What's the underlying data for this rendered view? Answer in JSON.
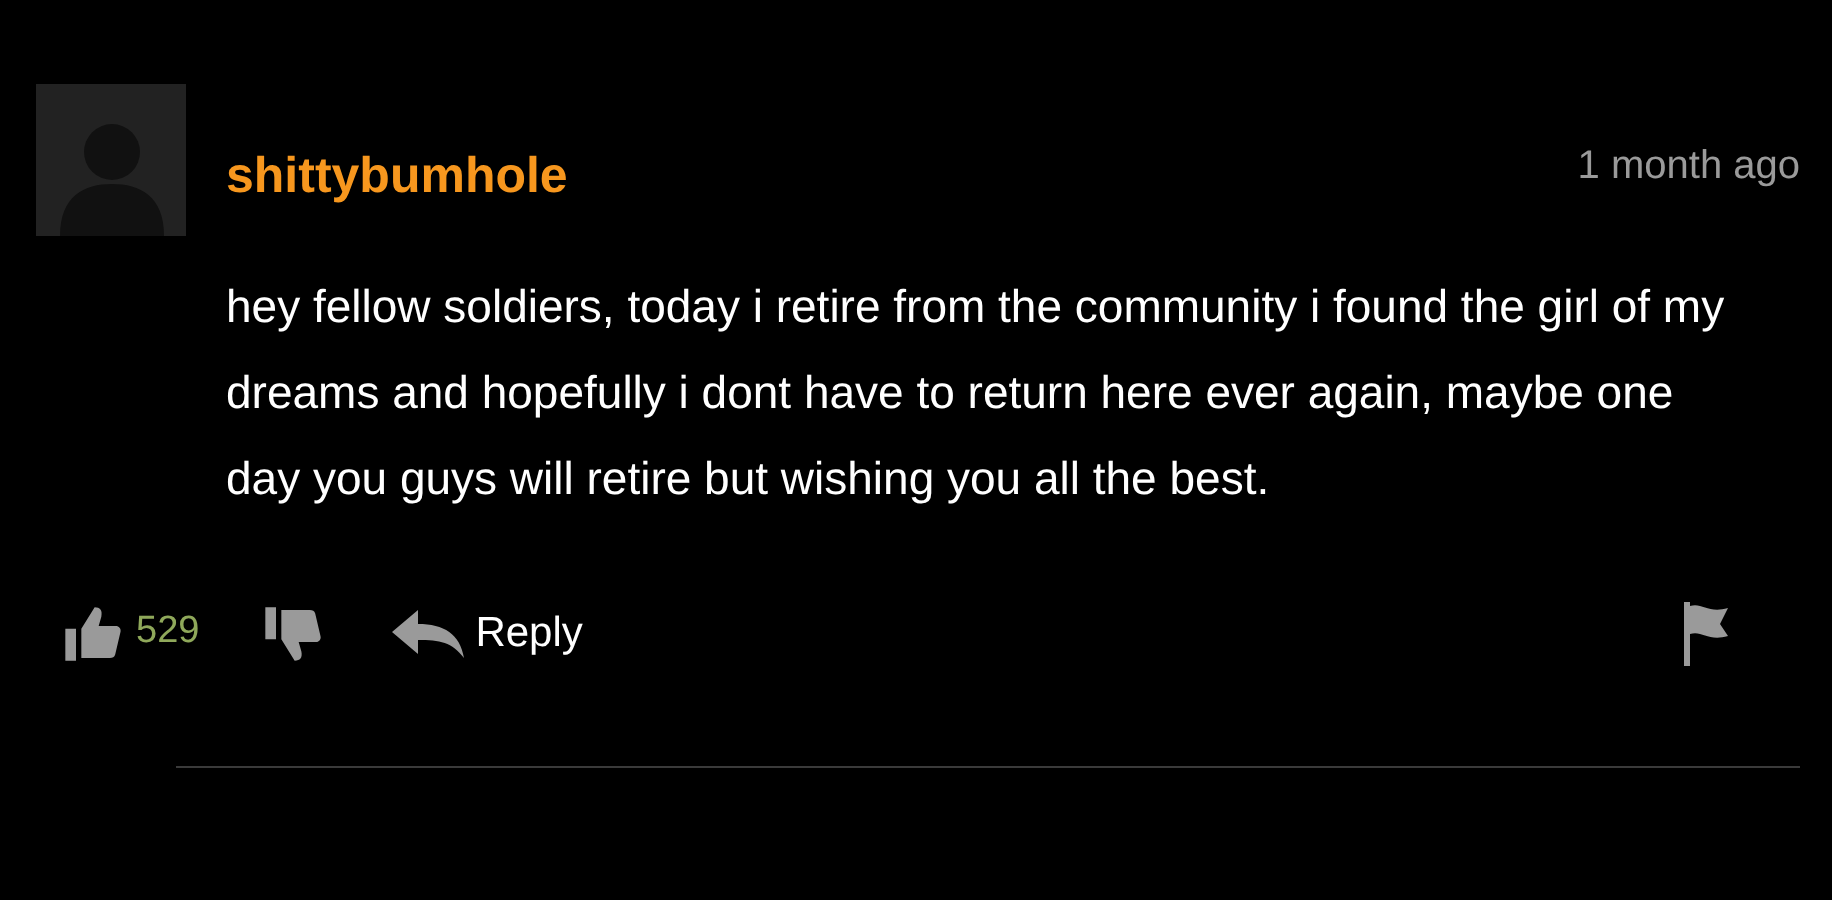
{
  "comment": {
    "username": "shittybumhole",
    "time": "1 month ago",
    "body": "hey fellow soldiers, today i retire from the community i found the girl of my dreams and hopefully i dont have to return here ever again, maybe one day you guys will retire but wishing you all the best.",
    "likes": "529",
    "reply": "Reply"
  }
}
